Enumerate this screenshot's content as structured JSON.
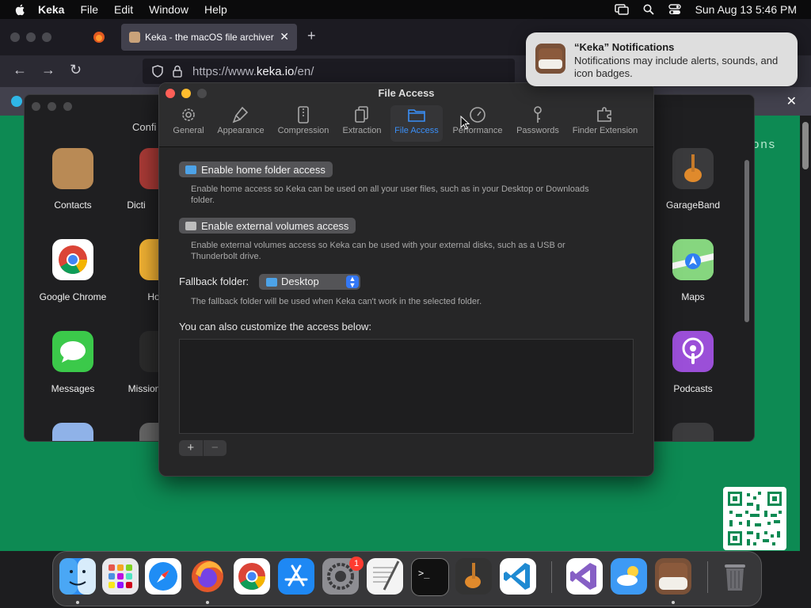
{
  "menubar": {
    "app_name": "Keka",
    "menus": [
      "File",
      "Edit",
      "Window",
      "Help"
    ],
    "datetime": "Sun Aug 13  5:46 PM"
  },
  "browser": {
    "tab_title": "Keka - the macOS file archiver",
    "url_prefix": "https://www.",
    "url_domain": "keka.io",
    "url_path": "/en/",
    "page_partial_text": "ons"
  },
  "launcher": {
    "config_title": "Confi",
    "apps_left": [
      {
        "label": "Contacts"
      },
      {
        "label": "Google Chrome"
      },
      {
        "label": "Messages"
      }
    ],
    "apps_second": [
      {
        "label": "Dicti"
      },
      {
        "label": "Ho"
      },
      {
        "label": "Mission"
      }
    ],
    "apps_right": [
      {
        "label": "GarageBand"
      },
      {
        "label": "Maps"
      },
      {
        "label": "Podcasts"
      }
    ]
  },
  "dialog": {
    "title": "File Access",
    "toolbar": [
      {
        "label": "General",
        "icon": "gear-icon"
      },
      {
        "label": "Appearance",
        "icon": "brush-icon"
      },
      {
        "label": "Compression",
        "icon": "archive-icon"
      },
      {
        "label": "Extraction",
        "icon": "documents-icon"
      },
      {
        "label": "File Access",
        "icon": "folder-icon"
      },
      {
        "label": "Performance",
        "icon": "gauge-icon"
      },
      {
        "label": "Passwords",
        "icon": "key-icon"
      },
      {
        "label": "Finder Extension",
        "icon": "puzzle-icon"
      }
    ],
    "active_tab": "File Access",
    "home_button": "Enable home folder access",
    "home_desc": "Enable home access so Keka can be used on all your user files, such as in your Desktop or Downloads folder.",
    "external_button": "Enable external volumes access",
    "external_desc": "Enable external volumes access so Keka can be used with your external disks, such as a USB or Thunderbolt drive.",
    "fallback_label": "Fallback folder:",
    "fallback_value": "Desktop",
    "fallback_desc": "The fallback folder will be used when Keka can't work in the selected folder.",
    "custom_label": "You can also customize the access below:",
    "add": "+",
    "remove": "−"
  },
  "notification": {
    "title": "“Keka” Notifications",
    "body": "Notifications may include alerts, sounds, and icon badges."
  },
  "dock": {
    "system_settings_badge": "1"
  },
  "colors": {
    "accent": "#3a8ef6",
    "page_bg": "#0d8a53"
  }
}
